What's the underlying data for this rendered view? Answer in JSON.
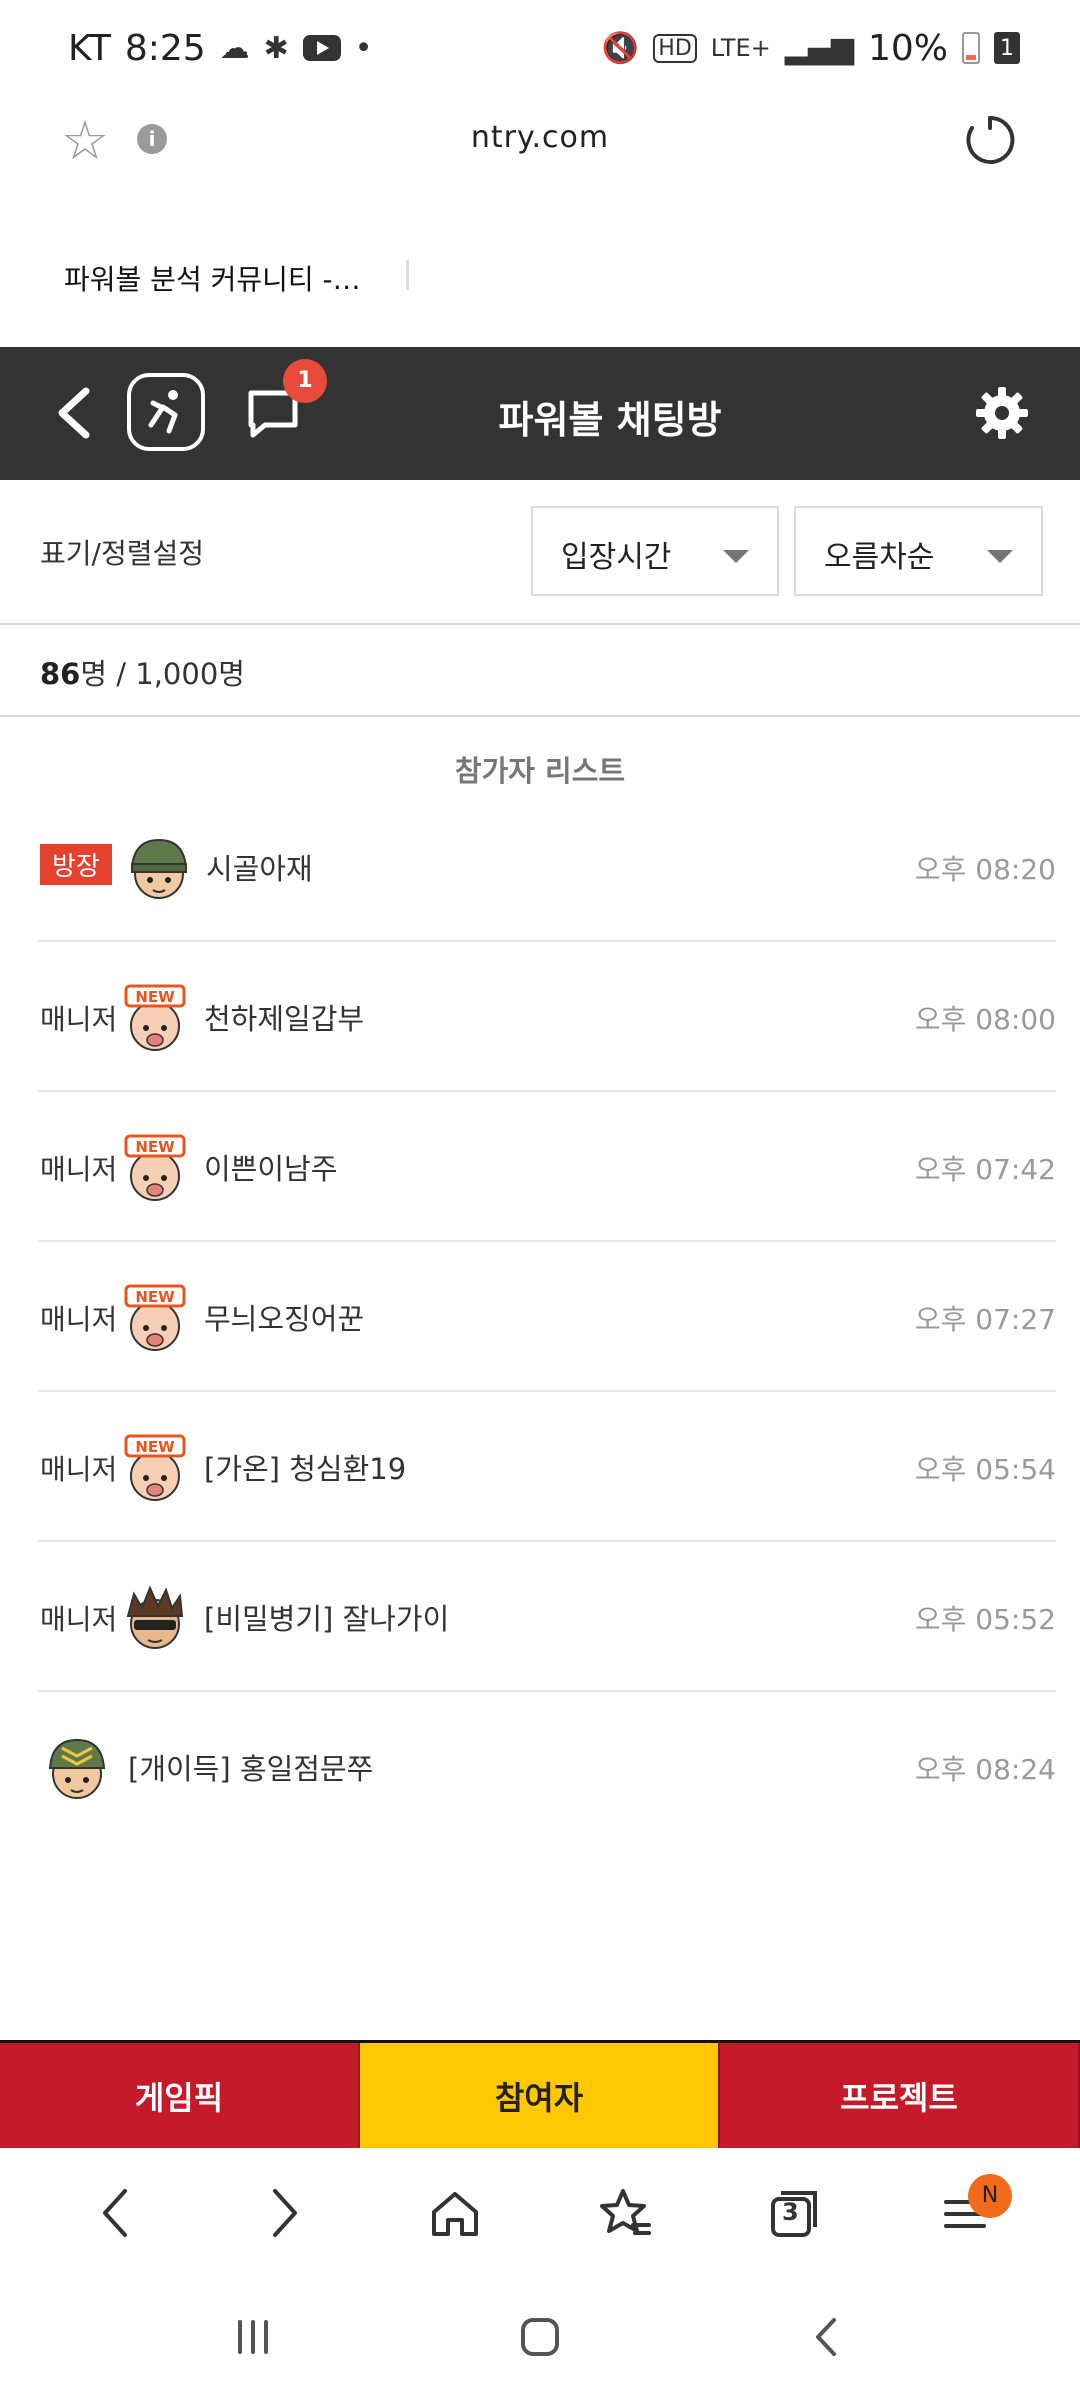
{
  "statusbar": {
    "carrier": "KT",
    "time": "8:25",
    "battery": "10%",
    "sim": "1",
    "network": "LTE+"
  },
  "browser": {
    "url": "ntry.com",
    "tab_title": "파워볼 분석 커뮤니티 -…"
  },
  "header": {
    "title": "파워볼 채팅방",
    "chat_badge": "1"
  },
  "sort": {
    "label": "표기/정렬설정",
    "option1": "입장시간",
    "option2": "오름차순"
  },
  "count": {
    "current": "86",
    "current_unit": "명",
    "sep": " / ",
    "max": "1,000명"
  },
  "list_title": "참가자 리스트",
  "participants": [
    {
      "role": "방장",
      "name": "시골아재",
      "time": "오후 08:20",
      "avatar": "army-helmet-avatar"
    },
    {
      "role": "매니저",
      "name": "천하제일갑부",
      "time": "오후 08:00",
      "avatar": "new-baby-avatar"
    },
    {
      "role": "매니저",
      "name": "이쁜이남주",
      "time": "오후 07:42",
      "avatar": "new-baby-avatar"
    },
    {
      "role": "매니저",
      "name": "무늬오징어꾼",
      "time": "오후 07:27",
      "avatar": "new-baby-avatar"
    },
    {
      "role": "매니저",
      "name": "[가온] 청심환19",
      "time": "오후 05:54",
      "avatar": "new-baby-avatar"
    },
    {
      "role": "매니저",
      "name": "[비밀병기] 잘나가이",
      "time": "오후 05:52",
      "avatar": "spiky-sunglasses-avatar"
    },
    {
      "role": "",
      "name": "[개이득] 홍일점문쭈",
      "time": "오후 08:24",
      "avatar": "sergeant-avatar"
    }
  ],
  "bottom_tabs": [
    {
      "label": "게임픽",
      "active": false
    },
    {
      "label": "참여자",
      "active": true
    },
    {
      "label": "프로젝트",
      "active": false
    }
  ],
  "browser_nav": {
    "tabs_count": "3",
    "menu_badge": "N"
  },
  "colors": {
    "header_bg": "#333333",
    "tab_red": "#c41a2a",
    "tab_active": "#ffc800",
    "host_badge": "#e4412e"
  }
}
